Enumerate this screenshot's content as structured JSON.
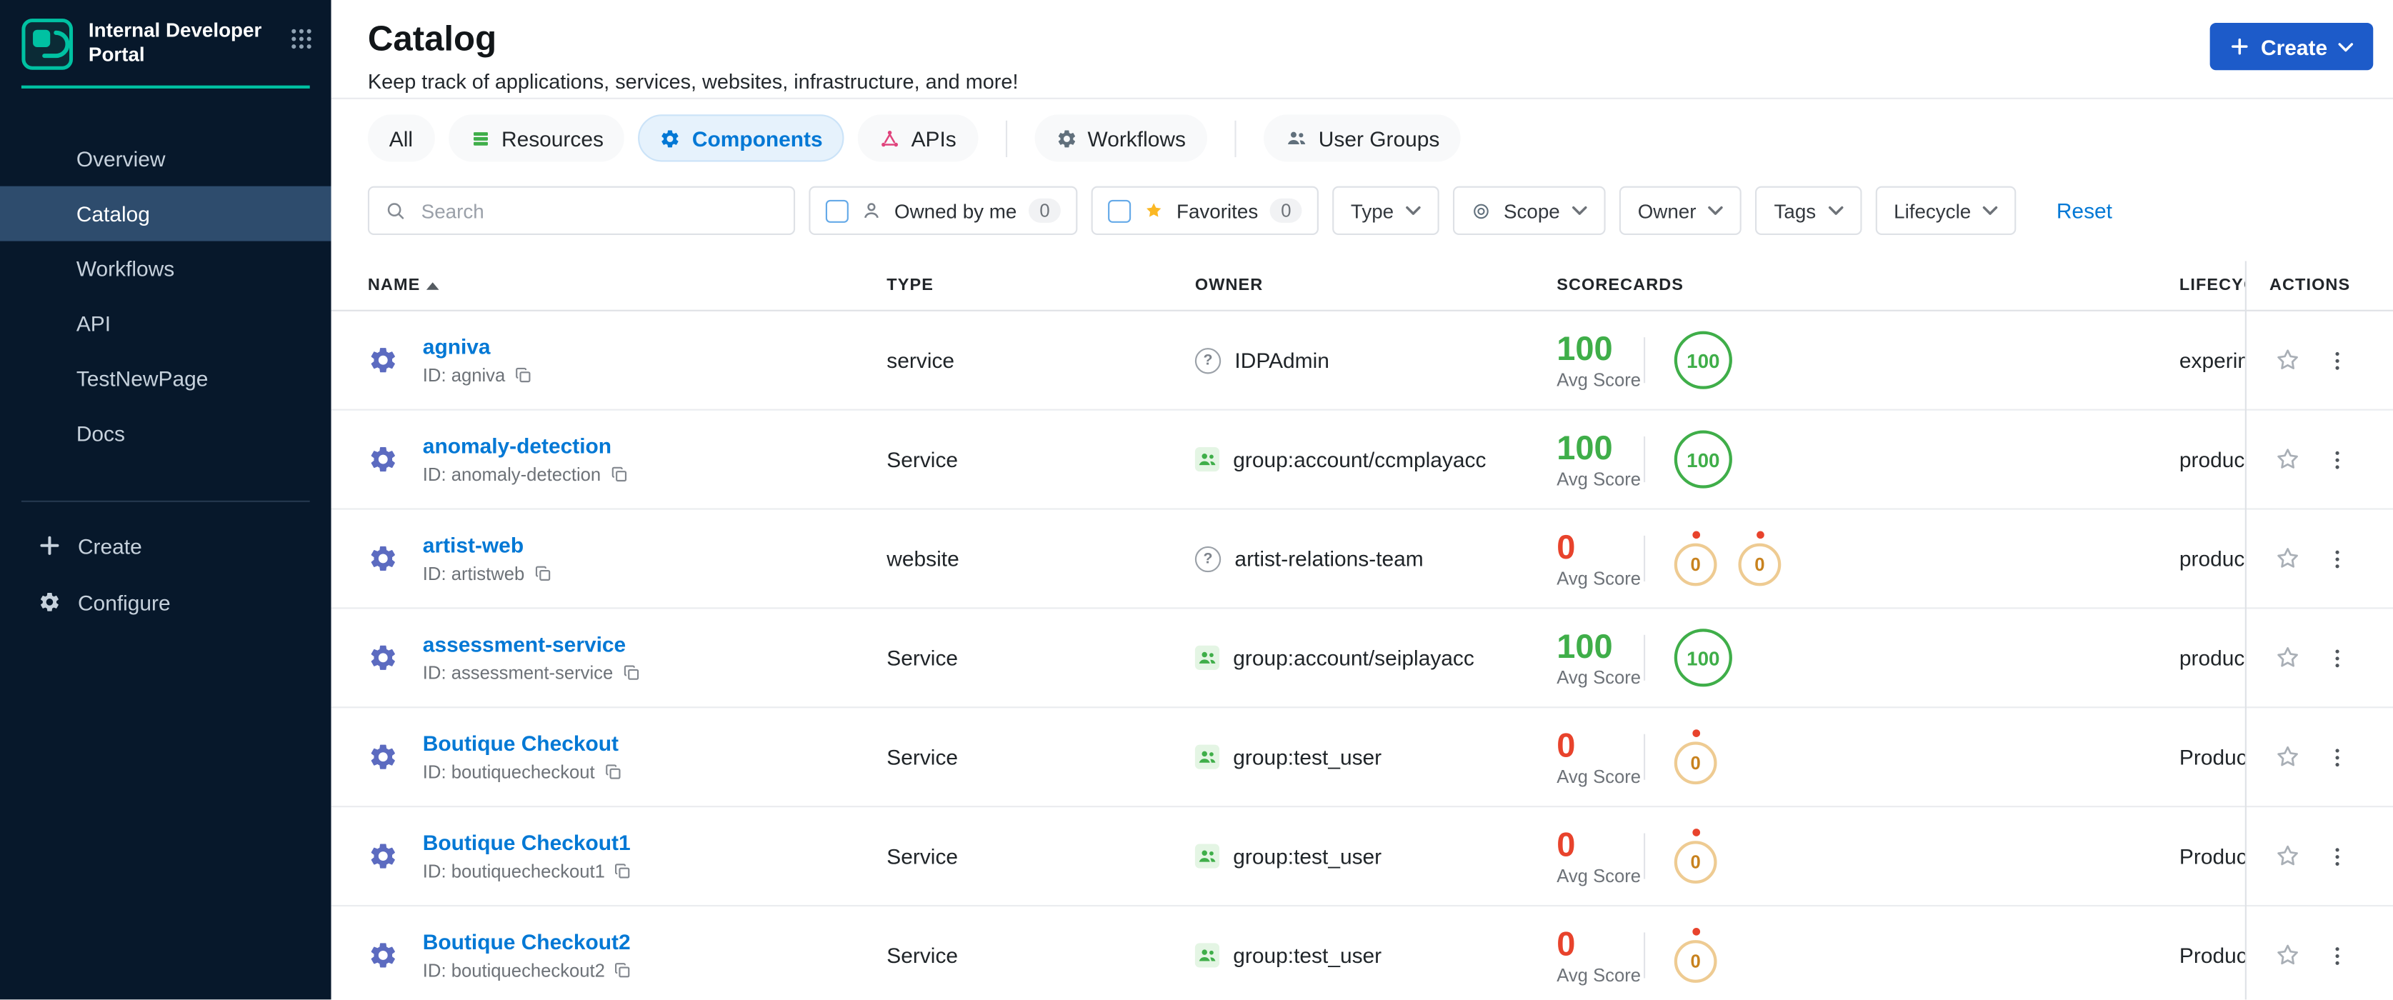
{
  "colors": {
    "sidebar_bg": "#07182b",
    "sidebar_active": "#2e4c6d",
    "brand_teal": "#00c1a2",
    "link_blue": "#0278d5",
    "button_blue": "#1d5bc9",
    "score_green": "#3fae49",
    "score_red": "#e8432c",
    "warn_ring": "#eecb92",
    "warn_text": "#c8821e",
    "favorite_yellow": "#fbb824",
    "component_icon": "#5c6bc0"
  },
  "sidebar": {
    "brand_title": "Internal Developer Portal",
    "nav_items": [
      {
        "label": "Overview",
        "active": false
      },
      {
        "label": "Catalog",
        "active": true
      },
      {
        "label": "Workflows",
        "active": false
      },
      {
        "label": "API",
        "active": false
      },
      {
        "label": "TestNewPage",
        "active": false
      },
      {
        "label": "Docs",
        "active": false
      }
    ],
    "footer_items": [
      {
        "label": "Create",
        "icon": "plus-icon"
      },
      {
        "label": "Configure",
        "icon": "gear-icon"
      }
    ]
  },
  "header": {
    "title": "Catalog",
    "subtitle": "Keep track of applications, services, websites, infrastructure, and more!",
    "create_label": "Create"
  },
  "tabs": [
    {
      "label": "All",
      "icon": null,
      "active": false,
      "divider_after": false
    },
    {
      "label": "Resources",
      "icon": "resources-stack-icon",
      "active": false,
      "divider_after": false
    },
    {
      "label": "Components",
      "icon": "components-gear-icon",
      "active": true,
      "divider_after": false
    },
    {
      "label": "APIs",
      "icon": "apis-icon",
      "active": false,
      "divider_after": true
    },
    {
      "label": "Workflows",
      "icon": "workflows-icon",
      "active": false,
      "divider_after": true
    },
    {
      "label": "User Groups",
      "icon": "user-groups-icon",
      "active": false,
      "divider_after": false
    }
  ],
  "filters": {
    "search_placeholder": "Search",
    "owned_by_me": {
      "label": "Owned by me",
      "count": "0"
    },
    "favorites": {
      "label": "Favorites",
      "count": "0"
    },
    "dropdowns": [
      {
        "label": "Type",
        "icon": null
      },
      {
        "label": "Scope",
        "icon": "scope-icon"
      },
      {
        "label": "Owner",
        "icon": null
      },
      {
        "label": "Tags",
        "icon": null
      },
      {
        "label": "Lifecycle",
        "icon": null
      }
    ],
    "reset_label": "Reset"
  },
  "table": {
    "columns": [
      "NAME",
      "TYPE",
      "OWNER",
      "SCORECARDS",
      "LIFECYCLE",
      "ACTIONS"
    ],
    "avg_score_label": "Avg Score",
    "rows": [
      {
        "name": "agniva",
        "id": "ID: agniva",
        "type": "service",
        "owner": {
          "name": "IDPAdmin",
          "icon": "unknown"
        },
        "score": {
          "value": "100",
          "tone": "good"
        },
        "badges": [
          {
            "value": "100",
            "tone": "good",
            "dot": false
          }
        ],
        "lifecycle": "experimental"
      },
      {
        "name": "anomaly-detection",
        "id": "ID: anomaly-detection",
        "type": "Service",
        "owner": {
          "name": "group:account/ccmplayacc",
          "icon": "group"
        },
        "score": {
          "value": "100",
          "tone": "good"
        },
        "badges": [
          {
            "value": "100",
            "tone": "good",
            "dot": false
          }
        ],
        "lifecycle": "production"
      },
      {
        "name": "artist-web",
        "id": "ID: artistweb",
        "type": "website",
        "owner": {
          "name": "artist-relations-team",
          "icon": "unknown"
        },
        "score": {
          "value": "0",
          "tone": "bad"
        },
        "badges": [
          {
            "value": "0",
            "tone": "warn",
            "dot": true
          },
          {
            "value": "0",
            "tone": "warn",
            "dot": true
          }
        ],
        "lifecycle": "production"
      },
      {
        "name": "assessment-service",
        "id": "ID: assessment-service",
        "type": "Service",
        "owner": {
          "name": "group:account/seiplayacc",
          "icon": "group"
        },
        "score": {
          "value": "100",
          "tone": "good"
        },
        "badges": [
          {
            "value": "100",
            "tone": "good",
            "dot": false
          }
        ],
        "lifecycle": "production"
      },
      {
        "name": "Boutique Checkout",
        "id": "ID: boutiquecheckout",
        "type": "Service",
        "owner": {
          "name": "group:test_user",
          "icon": "group"
        },
        "score": {
          "value": "0",
          "tone": "bad"
        },
        "badges": [
          {
            "value": "0",
            "tone": "warn",
            "dot": true
          }
        ],
        "lifecycle": "Production"
      },
      {
        "name": "Boutique Checkout1",
        "id": "ID: boutiquecheckout1",
        "type": "Service",
        "owner": {
          "name": "group:test_user",
          "icon": "group"
        },
        "score": {
          "value": "0",
          "tone": "bad"
        },
        "badges": [
          {
            "value": "0",
            "tone": "warn",
            "dot": true
          }
        ],
        "lifecycle": "Production"
      },
      {
        "name": "Boutique Checkout2",
        "id": "ID: boutiquecheckout2",
        "type": "Service",
        "owner": {
          "name": "group:test_user",
          "icon": "group"
        },
        "score": {
          "value": "0",
          "tone": "bad"
        },
        "badges": [
          {
            "value": "0",
            "tone": "warn",
            "dot": true
          }
        ],
        "lifecycle": "Production"
      }
    ]
  }
}
